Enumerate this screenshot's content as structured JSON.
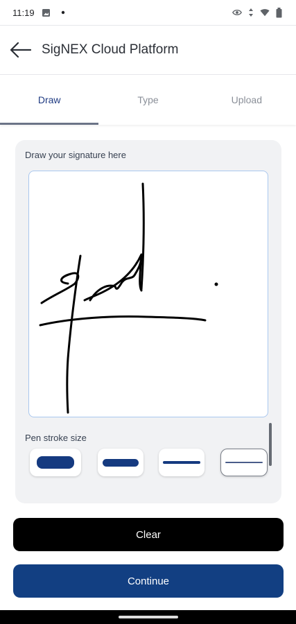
{
  "status_bar": {
    "time": "11:19",
    "icons": [
      "image-icon",
      "dot-icon",
      "eye-icon",
      "data-arrows-icon",
      "wifi-icon",
      "battery-icon"
    ]
  },
  "app_bar": {
    "title": "SigNEX Cloud Platform",
    "back_icon": "back-arrow-icon"
  },
  "tabs": [
    {
      "label": "Draw",
      "active": true
    },
    {
      "label": "Type",
      "active": false
    },
    {
      "label": "Upload",
      "active": false
    }
  ],
  "signature": {
    "label": "Draw your signature here"
  },
  "pen_stroke": {
    "label": "Pen stroke size",
    "options": [
      "thickest",
      "thick",
      "medium",
      "thin"
    ],
    "selected_index": 3
  },
  "buttons": {
    "clear": "Clear",
    "continue": "Continue"
  },
  "colors": {
    "primary": "#123f82",
    "active_tab_text": "#1f3b82",
    "card_bg": "#f1f2f4",
    "canvas_border": "#a9c7ee"
  }
}
